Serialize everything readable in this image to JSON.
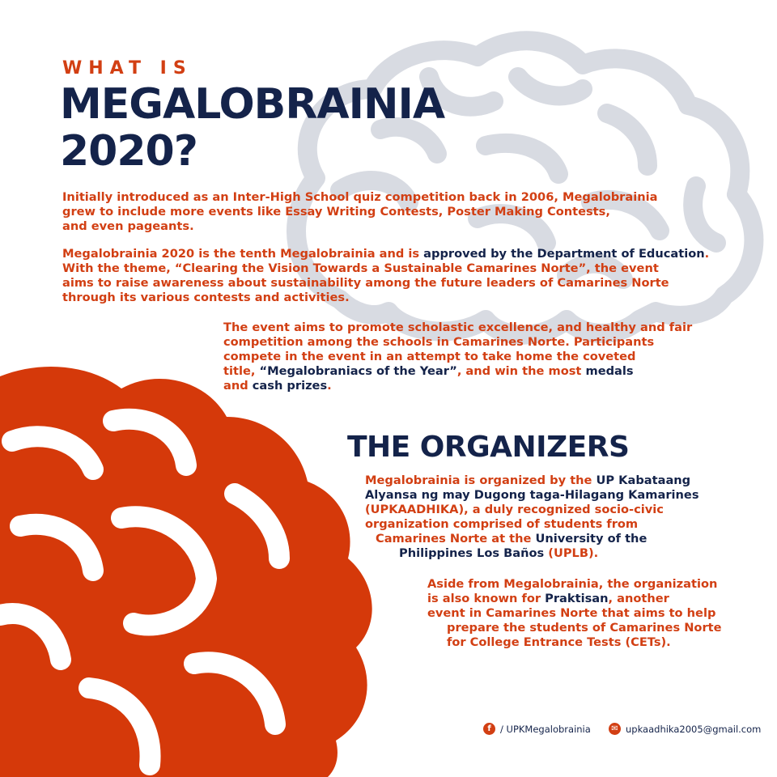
{
  "colors": {
    "accent": "#d23f13",
    "navy": "#14234a",
    "brain_gray": "#d8dbe2"
  },
  "header": {
    "kicker": "WHAT IS",
    "title_line1": "MEGALOBRAINIA",
    "title_line2": "2020?"
  },
  "intro": [
    "Initially introduced as an Inter-High School quiz competition back in 2006, Megalobrainia",
    "grew to include more events like Essay Writing Contests, Poster Making Contests,",
    "and even pageants."
  ],
  "tenth": {
    "l1a": "Megalobrainia 2020 is the tenth Megalobrainia and is ",
    "l1b": "approved by the Department of Education",
    "l1c": ".",
    "l2": "With the theme, “Clearing the Vision Towards a Sustainable Camarines Norte”, the event",
    "l3": "aims to raise awareness about sustainability among the future leaders of Camarines Norte",
    "l4": "through its various contests and activities."
  },
  "aims": {
    "l1": "The event aims to promote scholastic excellence, and healthy and fair",
    "l2": "competition among the schools in Camarines Norte. Participants",
    "l3": "compete in the event in an attempt to take home the coveted",
    "l4a": "title, ",
    "l4b": "“Megalobraniacs of the Year”",
    "l4c": ", and win the most ",
    "l4d": "medals",
    "l5a": "and ",
    "l5b": "cash prizes",
    "l5c": "."
  },
  "organizers": {
    "heading": "THE ORGANIZERS",
    "l1a": "Megalobrainia is organized by the ",
    "l1b": "UP Kabataang",
    "l2": "Alyansa ng may Dugong taga-Hilagang Kamarines",
    "l3": "(UPKAADHIKA), a duly recognized socio-civic",
    "l4": "organization comprised of students from",
    "l5a": "Camarines Norte at the ",
    "l5b": "University of the",
    "l6a": "Philippines Los Baños",
    "l6b": " (UPLB)."
  },
  "also": {
    "l1": "Aside from Megalobrainia, the organization",
    "l2a": "is also known for ",
    "l2b": "Praktisan",
    "l2c": ", another",
    "l3": "event in Camarines Norte that aims to help",
    "l4": "prepare the students of Camarines Norte",
    "l5": "for College Entrance Tests (CETs)."
  },
  "footer": {
    "facebook_icon": "facebook-icon",
    "facebook_text": "/ UPKMegalobrainia",
    "email_icon": "email-icon",
    "email_text": "upkaadhika2005@gmail.com"
  }
}
